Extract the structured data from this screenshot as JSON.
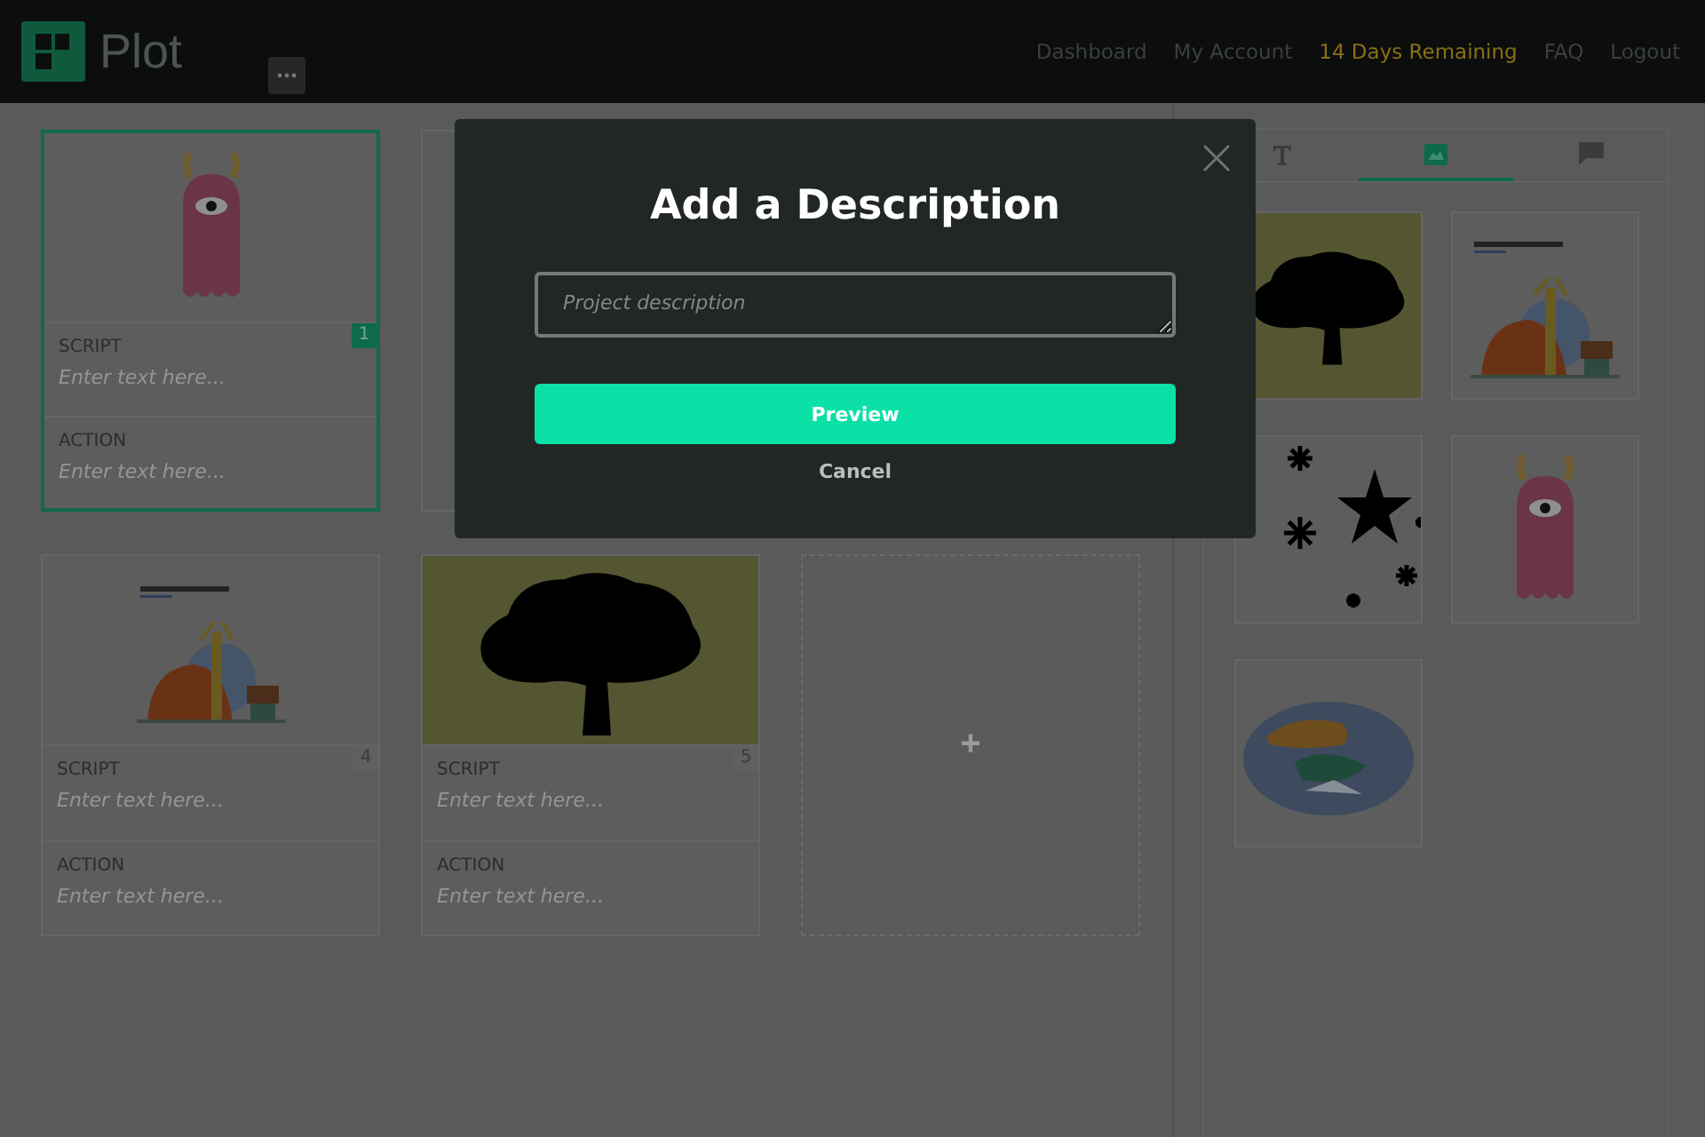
{
  "header": {
    "logo_text": "Plot",
    "nav": [
      {
        "label": "Dashboard",
        "highlighted": false
      },
      {
        "label": "My Account",
        "highlighted": false
      },
      {
        "label": "14 Days Remaining",
        "highlighted": true
      },
      {
        "label": "FAQ",
        "highlighted": false
      },
      {
        "label": "Logout",
        "highlighted": false
      }
    ]
  },
  "slides": [
    {
      "kind": "card",
      "image": {
        "kind": "monster"
      },
      "number": "1",
      "selected": true,
      "script_label": "SCRIPT",
      "script_placeholder": "Enter text here...",
      "action_label": "ACTION",
      "action_placeholder": "Enter text here..."
    },
    {
      "kind": "covered"
    },
    {
      "kind": "covered"
    },
    {
      "kind": "card",
      "image": {
        "kind": "forest"
      },
      "number": "4",
      "selected": false,
      "script_label": "SCRIPT",
      "script_placeholder": "Enter text here...",
      "action_label": "ACTION",
      "action_placeholder": "Enter text here..."
    },
    {
      "kind": "card",
      "image": {
        "kind": "tree"
      },
      "number": "5",
      "selected": false,
      "script_label": "SCRIPT",
      "script_placeholder": "Enter text here...",
      "action_label": "ACTION",
      "action_placeholder": "Enter text here..."
    },
    {
      "kind": "add",
      "label": "+"
    }
  ],
  "panel": {
    "tabs": [
      {
        "kind": "text",
        "selected": false
      },
      {
        "kind": "image",
        "selected": true
      },
      {
        "kind": "comment",
        "selected": false
      }
    ],
    "gallery": [
      {
        "kind": "tree"
      },
      {
        "kind": "forest"
      },
      {
        "kind": "stars"
      },
      {
        "kind": "monster"
      },
      {
        "kind": "tiger"
      }
    ]
  },
  "modal": {
    "title": "Add a Description",
    "placeholder": "Project description",
    "primary": "Preview",
    "cancel": "Cancel"
  }
}
